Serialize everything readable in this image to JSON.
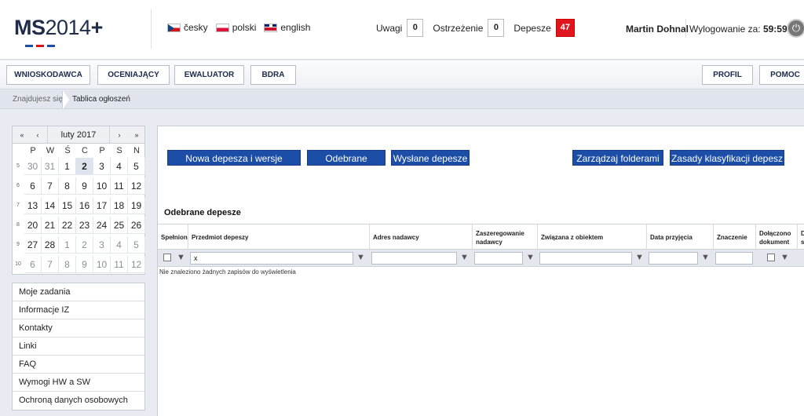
{
  "header": {
    "logo": {
      "brand": "MS",
      "year": "2014",
      "plus": "+"
    },
    "logo_colors": [
      "#1c4ea8",
      "#d7141a",
      "#1c4ea8"
    ],
    "languages": [
      {
        "label": "česky",
        "flag": "czech-flag-icon"
      },
      {
        "label": "polski",
        "flag": "polish-flag-icon"
      },
      {
        "label": "english",
        "flag": "uk-flag-icon"
      }
    ],
    "counters": [
      {
        "label": "Uwagi",
        "value": "0"
      },
      {
        "label": "Ostrzeżenie",
        "value": "0"
      },
      {
        "label": "Depesze",
        "value": "47"
      }
    ],
    "user_name": "Martin Dohnal",
    "logout_label": "Wylogowanie za:",
    "logout_time": "59:59",
    "power_icon": "power-icon"
  },
  "navbar": {
    "left": [
      "WNIOSKODAWCA",
      "OCENIAJĄCY",
      "EWALUATOR",
      "BDRA"
    ],
    "right": [
      "PROFIL",
      "POMOC"
    ]
  },
  "breadcrumb": {
    "label": "Znajdujesz się:",
    "current": "Tablica ogłoszeń"
  },
  "calendar": {
    "month": "luty 2017",
    "nav": {
      "first": "«",
      "prev": "‹",
      "next": "›",
      "last": "»"
    },
    "weekdays": [
      "P",
      "W",
      "Ś",
      "C",
      "P",
      "S",
      "N"
    ],
    "weeks": [
      {
        "num": "5",
        "days": [
          [
            "30",
            true
          ],
          [
            "31",
            true
          ],
          [
            "1",
            false
          ],
          [
            "2",
            false
          ],
          [
            "3",
            false
          ],
          [
            "4",
            false
          ],
          [
            "5",
            false
          ]
        ]
      },
      {
        "num": "6",
        "days": [
          [
            "6",
            false
          ],
          [
            "7",
            false
          ],
          [
            "8",
            false
          ],
          [
            "9",
            false
          ],
          [
            "10",
            false
          ],
          [
            "11",
            false
          ],
          [
            "12",
            false
          ]
        ]
      },
      {
        "num": "7",
        "days": [
          [
            "13",
            false
          ],
          [
            "14",
            false
          ],
          [
            "15",
            false
          ],
          [
            "16",
            false
          ],
          [
            "17",
            false
          ],
          [
            "18",
            false
          ],
          [
            "19",
            false
          ]
        ]
      },
      {
        "num": "8",
        "days": [
          [
            "20",
            false
          ],
          [
            "21",
            false
          ],
          [
            "22",
            false
          ],
          [
            "23",
            false
          ],
          [
            "24",
            false
          ],
          [
            "25",
            false
          ],
          [
            "26",
            false
          ]
        ]
      },
      {
        "num": "9",
        "days": [
          [
            "27",
            false
          ],
          [
            "28",
            false
          ],
          [
            "1",
            true
          ],
          [
            "2",
            true
          ],
          [
            "3",
            true
          ],
          [
            "4",
            true
          ],
          [
            "5",
            true
          ]
        ]
      },
      {
        "num": "10",
        "days": [
          [
            "6",
            true
          ],
          [
            "7",
            true
          ],
          [
            "8",
            true
          ],
          [
            "9",
            true
          ],
          [
            "10",
            true
          ],
          [
            "11",
            true
          ],
          [
            "12",
            true
          ]
        ]
      }
    ]
  },
  "side_menu": [
    "Moje zadania",
    "Informacje IZ",
    "Kontakty",
    "Linki",
    "FAQ",
    "Wymogi HW a SW",
    "Ochroną danych osobowych"
  ],
  "actions": {
    "new": "Nowa depesza i wersje robocze",
    "received": "Odebrane depesze",
    "sent": "Wysłane depesze",
    "folders": "Zarządzaj folderami",
    "rules": "Zasady klasyfikacji depesz"
  },
  "section_title": "Odebrane depesze",
  "table": {
    "columns": [
      "Spełnion",
      "Przedmiot depeszy",
      "Adres nadawcy",
      "Zaszeregowanie nadawcy",
      "Związana z obiektem",
      "Data przyjęcia",
      "Znaczenie",
      "Dołączono dokument",
      "D s"
    ],
    "filter_subject": "x",
    "empty_message": "Nie znaleziono żadnych zapisów do wyświetlenia"
  }
}
